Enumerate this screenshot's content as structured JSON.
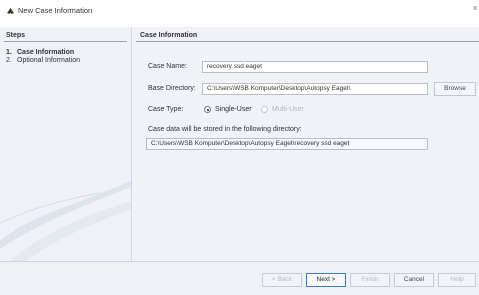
{
  "window": {
    "title": "New Case Information",
    "close_glyph": "x",
    "icon": "autopsy-app-icon"
  },
  "steps": {
    "header": "Steps",
    "items": [
      {
        "num": "1.",
        "label": "Case Information",
        "active": true
      },
      {
        "num": "2.",
        "label": "Optional Information",
        "active": false
      }
    ]
  },
  "case_info": {
    "header": "Case Information",
    "case_name_label": "Case Name:",
    "case_name_value": "recovery ssd eaget",
    "base_dir_label": "Base Directory:",
    "base_dir_value": "C:\\Users\\WSB Komputer\\Desktop\\Autopsy Eaget\\",
    "browse_label": "Browse",
    "case_type_label": "Case Type:",
    "single_user_label": "Single-User",
    "multi_user_label": "Multi-User",
    "case_type_selected": "Single-User",
    "store_note": "Case data will be stored in the following directory:",
    "store_path": "C:\\Users\\WSB Komputer\\Desktop\\Autopsy Eaget\\recovery ssd eaget"
  },
  "buttons": {
    "back": "< Back",
    "next": "Next >",
    "finish": "Finish",
    "cancel": "Cancel",
    "help": "Help"
  }
}
